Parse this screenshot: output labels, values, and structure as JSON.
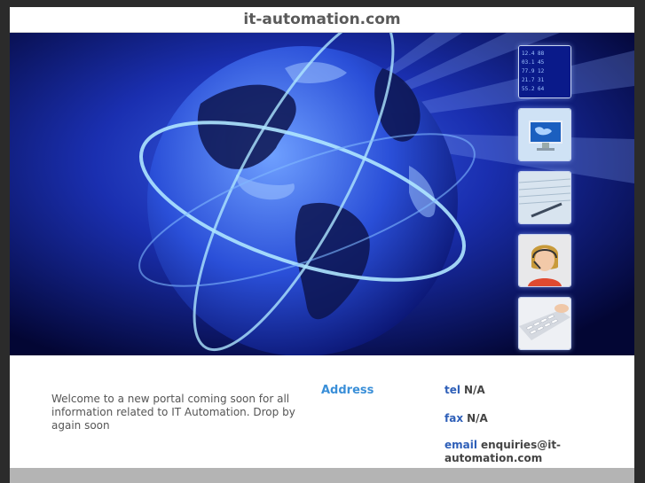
{
  "header": {
    "title": "it-automation.com"
  },
  "banner": {
    "thumbnails": [
      {
        "icon": "stock-ticker-icon"
      },
      {
        "icon": "monitor-map-icon"
      },
      {
        "icon": "document-pen-icon"
      },
      {
        "icon": "support-agent-icon"
      },
      {
        "icon": "keyboard-icon"
      }
    ]
  },
  "info": {
    "welcome_text": "Welcome to a new portal coming soon for all information related to IT Automation. Drop by again soon",
    "address_label": "Address",
    "tel_label": "tel",
    "tel_value": "N/A",
    "fax_label": "fax",
    "fax_value": "N/A",
    "email_label": "email",
    "email_value": "enquiries@it-automation.com"
  },
  "colors": {
    "accent": "#3a8fd8",
    "label_blue": "#2e5fb8",
    "banner_bg": "#050a3a",
    "footer_bar": "#b4b4b4"
  }
}
